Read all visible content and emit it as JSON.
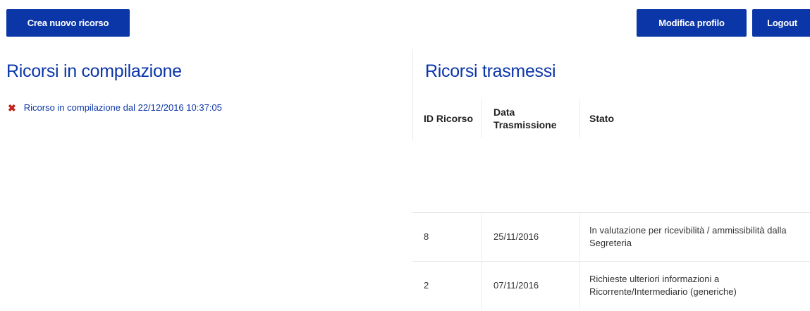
{
  "toolbar": {
    "new_label": "Crea nuovo ricorso",
    "profile_label": "Modifica profilo",
    "logout_label": "Logout"
  },
  "drafts": {
    "title": "Ricorsi in compilazione",
    "items": [
      {
        "icon": "x-icon",
        "label": "Ricorso in compilazione dal 22/12/2016 10:37:05"
      }
    ]
  },
  "submitted": {
    "title": "Ricorsi trasmessi",
    "columns": {
      "id": "ID Ricorso",
      "date": "Data Trasmissione",
      "stato": "Stato"
    },
    "rows": [
      {
        "id": "8",
        "date": "25/11/2016",
        "stato": "In valutazione per ricevibilità / ammissibilità dalla Segreteria"
      },
      {
        "id": "2",
        "date": "07/11/2016",
        "stato": "Richieste ulteriori informazioni a Ricorrente/Intermediario (generiche)"
      }
    ]
  },
  "colors": {
    "accent": "#0b36a8",
    "delete": "#c0221b"
  }
}
